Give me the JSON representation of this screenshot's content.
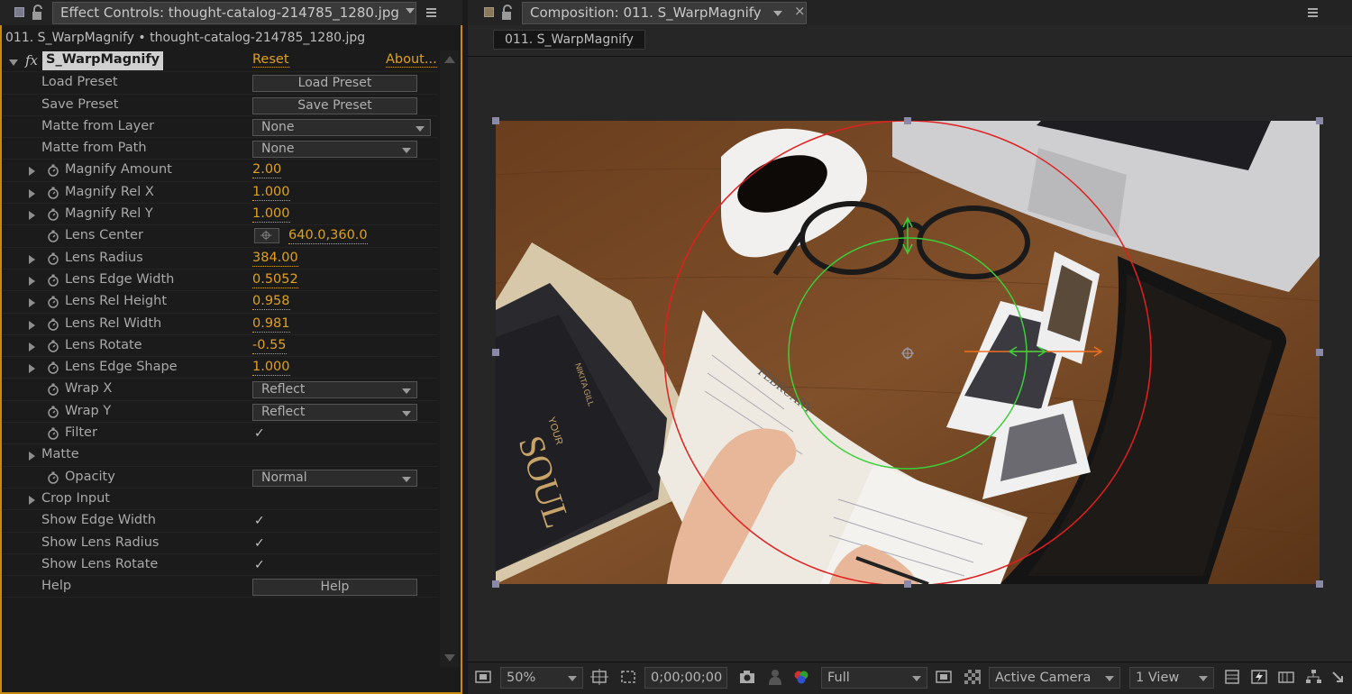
{
  "left_panel": {
    "tab_title": "Effect Controls: thought-catalog-214785_1280.jpg",
    "subtitle": "011. S_WarpMagnify • thought-catalog-214785_1280.jpg",
    "effect": {
      "name": "S_WarpMagnify",
      "reset_label": "Reset",
      "about_label": "About..."
    },
    "rows": {
      "load_preset": {
        "label": "Load Preset",
        "button": "Load Preset"
      },
      "save_preset": {
        "label": "Save Preset",
        "button": "Save Preset"
      },
      "matte_from_layer": {
        "label": "Matte from Layer",
        "value": "None"
      },
      "matte_from_path": {
        "label": "Matte from Path",
        "value": "None"
      },
      "magnify_amount": {
        "label": "Magnify Amount",
        "value": "2.00"
      },
      "magnify_rel_x": {
        "label": "Magnify Rel X",
        "value": "1.000"
      },
      "magnify_rel_y": {
        "label": "Magnify Rel Y",
        "value": "1.000"
      },
      "lens_center": {
        "label": "Lens Center",
        "value": "640.0,360.0"
      },
      "lens_radius": {
        "label": "Lens Radius",
        "value": "384.00"
      },
      "lens_edge_width": {
        "label": "Lens Edge Width",
        "value": "0.5052"
      },
      "lens_rel_height": {
        "label": "Lens Rel Height",
        "value": "0.958"
      },
      "lens_rel_width": {
        "label": "Lens Rel Width",
        "value": "0.981"
      },
      "lens_rotate": {
        "label": "Lens Rotate",
        "value": "-0.55"
      },
      "lens_edge_shape": {
        "label": "Lens Edge Shape",
        "value": "1.000"
      },
      "wrap_x": {
        "label": "Wrap X",
        "value": "Reflect"
      },
      "wrap_y": {
        "label": "Wrap Y",
        "value": "Reflect"
      },
      "filter": {
        "label": "Filter",
        "checked": "✓"
      },
      "matte": {
        "label": "Matte"
      },
      "opacity": {
        "label": "Opacity",
        "value": "Normal"
      },
      "crop_input": {
        "label": "Crop Input"
      },
      "show_edge_width": {
        "label": "Show Edge Width",
        "checked": "✓"
      },
      "show_lens_radius": {
        "label": "Show Lens Radius",
        "checked": "✓"
      },
      "show_lens_rotate": {
        "label": "Show Lens Rotate",
        "checked": "✓"
      },
      "help": {
        "label": "Help",
        "button": "Help"
      }
    }
  },
  "right_panel": {
    "tab_title": "Composition: 011. S_WarpMagnify",
    "close_glyph": "×",
    "comp_name": "011. S_WarpMagnify",
    "viewer_text": {
      "book_title": "SOUL",
      "book_your": "YOUR",
      "book_author": "NIKITA GILL",
      "notebook_month": "FEBRUARY"
    },
    "status": {
      "zoom": "50%",
      "timecode": "0;00;00;00",
      "resolution": "Full",
      "camera": "Active Camera",
      "views": "1 View"
    }
  },
  "colors": {
    "accent_orange": "#c98a10",
    "value_orange": "#e0a020",
    "lens_outer_red": "#e02020",
    "lens_inner_green": "#3ad03a",
    "rotate_handle_orange": "#f07020"
  }
}
